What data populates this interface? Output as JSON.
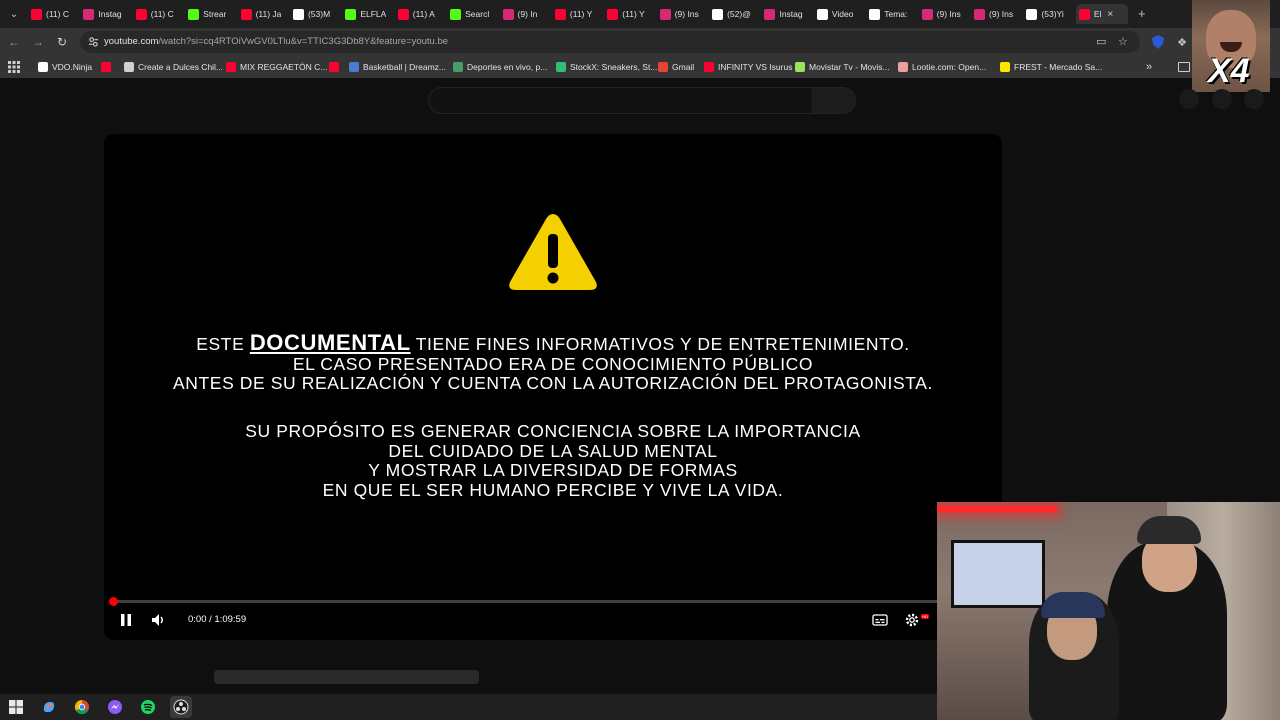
{
  "browser": {
    "tabs": [
      {
        "title": "(11) C",
        "icon": "youtube-icon",
        "color": "#ff0033"
      },
      {
        "title": "Instag",
        "icon": "instagram-icon",
        "color": "#d62976"
      },
      {
        "title": "(11) C",
        "icon": "youtube-icon",
        "color": "#ff0033"
      },
      {
        "title": "Strear",
        "icon": "kick-icon",
        "color": "#53fc18"
      },
      {
        "title": "(11) Ja",
        "icon": "youtube-icon",
        "color": "#ff0033"
      },
      {
        "title": "(53)M",
        "icon": "tiktok-icon",
        "color": "#ffffff"
      },
      {
        "title": "ELFLA",
        "icon": "kick-icon",
        "color": "#53fc18"
      },
      {
        "title": "(11) A",
        "icon": "youtube-icon",
        "color": "#ff0033"
      },
      {
        "title": "Searcl",
        "icon": "kick-icon",
        "color": "#53fc18"
      },
      {
        "title": "(9) In",
        "icon": "instagram-icon",
        "color": "#d62976"
      },
      {
        "title": "(11) Y",
        "icon": "youtube-icon",
        "color": "#ff0033"
      },
      {
        "title": "(11) Y",
        "icon": "youtube-icon",
        "color": "#ff0033"
      },
      {
        "title": "(9) Ins",
        "icon": "instagram-icon",
        "color": "#d62976"
      },
      {
        "title": "(52)@",
        "icon": "tiktok-icon",
        "color": "#ffffff"
      },
      {
        "title": "Instag",
        "icon": "instagram-icon",
        "color": "#d62976"
      },
      {
        "title": "Video",
        "icon": "tiktok-icon",
        "color": "#ffffff"
      },
      {
        "title": "Tema:",
        "icon": "tiktok-icon",
        "color": "#ffffff"
      },
      {
        "title": "(9) Ins",
        "icon": "instagram-icon",
        "color": "#d62976"
      },
      {
        "title": "(9) Ins",
        "icon": "instagram-icon",
        "color": "#d62976"
      },
      {
        "title": "(53)Yi",
        "icon": "tiktok-icon",
        "color": "#ffffff"
      },
      {
        "title": "El",
        "icon": "youtube-icon",
        "color": "#ff0033",
        "active": true
      }
    ],
    "url_host": "youtube.com",
    "url_rest": "/watch?si=cq4RTOiVwGV0LTlu&v=TTIC3G3Db8Y&feature=youtu.be",
    "bookmarks": [
      {
        "label": "VDO.Ninja",
        "icon": "vdo-ninja-icon",
        "color": "#ffffff"
      },
      {
        "label": "",
        "icon": "youtube-icon",
        "color": "#ff0033"
      },
      {
        "label": "Create a Dulces Chil...",
        "icon": "document-icon",
        "color": "#cfcfcf"
      },
      {
        "label": "MIX REGGAETÓN C...",
        "icon": "youtube-icon",
        "color": "#ff0033"
      },
      {
        "label": "",
        "icon": "youtube-icon",
        "color": "#ff0033"
      },
      {
        "label": "Basketball | Dreamz...",
        "icon": "dreamz-icon",
        "color": "#4a7bd0"
      },
      {
        "label": "Deportes en vivo, p...",
        "icon": "sports-icon",
        "color": "#4a9a6a"
      },
      {
        "label": "StockX: Sneakers, St...",
        "icon": "stockx-icon",
        "color": "#2fbf71"
      },
      {
        "label": "Gmail",
        "icon": "gmail-icon",
        "color": "#ea4335"
      },
      {
        "label": "INFINITY VS Isurus",
        "icon": "youtube-icon",
        "color": "#ff0033"
      },
      {
        "label": "Movistar Tv - Movis...",
        "icon": "movistar-icon",
        "color": "#9be15d"
      },
      {
        "label": "Lootie.com: Open...",
        "icon": "lootie-icon",
        "color": "#e8a0a0"
      },
      {
        "label": "FREST - Mercado Sa...",
        "icon": "mercado-icon",
        "color": "#ffe600"
      }
    ]
  },
  "overlay": {
    "text": "X4"
  },
  "video": {
    "disclaimer_pre": "ESTE ",
    "disclaimer_em": "DOCUMENTAL",
    "disclaimer_post": " TIENE FINES INFORMATIVOS Y DE ENTRETENIMIENTO.",
    "line2": "EL CASO PRESENTADO ERA DE CONOCIMIENTO PÚBLICO",
    "line3": "ANTES DE SU REALIZACIÓN Y CUENTA CON LA AUTORIZACIÓN DEL PROTAGONISTA.",
    "para2": [
      "SU PROPÓSITO ES GENERAR CONCIENCIA SOBRE LA IMPORTANCIA",
      "DEL CUIDADO DE LA SALUD MENTAL",
      "Y MOSTRAR LA DIVERSIDAD DE FORMAS",
      "EN QUE EL SER HUMANO PERCIBE Y VIVE LA VIDA."
    ],
    "time": "0:00 / 1:09:59",
    "progress": 0,
    "hd_badge": "HD",
    "warning_color": "#f5d000"
  }
}
